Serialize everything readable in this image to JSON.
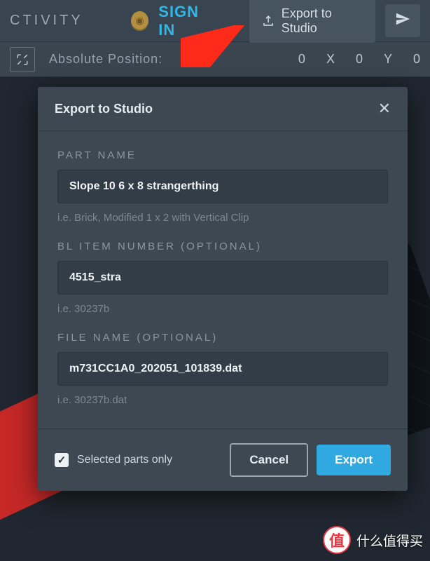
{
  "topbar": {
    "activity": "CTIVITY",
    "signin": "SIGN IN",
    "export_to_studio": "Export to Studio"
  },
  "subbar": {
    "absolute_position": "Absolute Position:",
    "coords": [
      "0",
      "X",
      "0",
      "Y",
      "0"
    ]
  },
  "dialog": {
    "title": "Export to Studio",
    "part_name_label": "PART NAME",
    "part_name_value": "Slope 10 6 x 8 strangerthing",
    "part_name_hint": "i.e. Brick, Modified 1 x 2 with Vertical Clip",
    "bl_item_label": "BL ITEM NUMBER (OPTIONAL)",
    "bl_item_value": "4515_stra",
    "bl_item_hint": "i.e. 30237b",
    "file_name_label": "FILE NAME (OPTIONAL)",
    "file_name_value": "m731CC1A0_202051_101839.dat",
    "file_name_hint": "i.e. 30237b.dat",
    "selected_parts_label": "Selected parts only",
    "cancel": "Cancel",
    "export": "Export"
  },
  "watermark": {
    "badge": "值",
    "text": "什么值得买"
  }
}
